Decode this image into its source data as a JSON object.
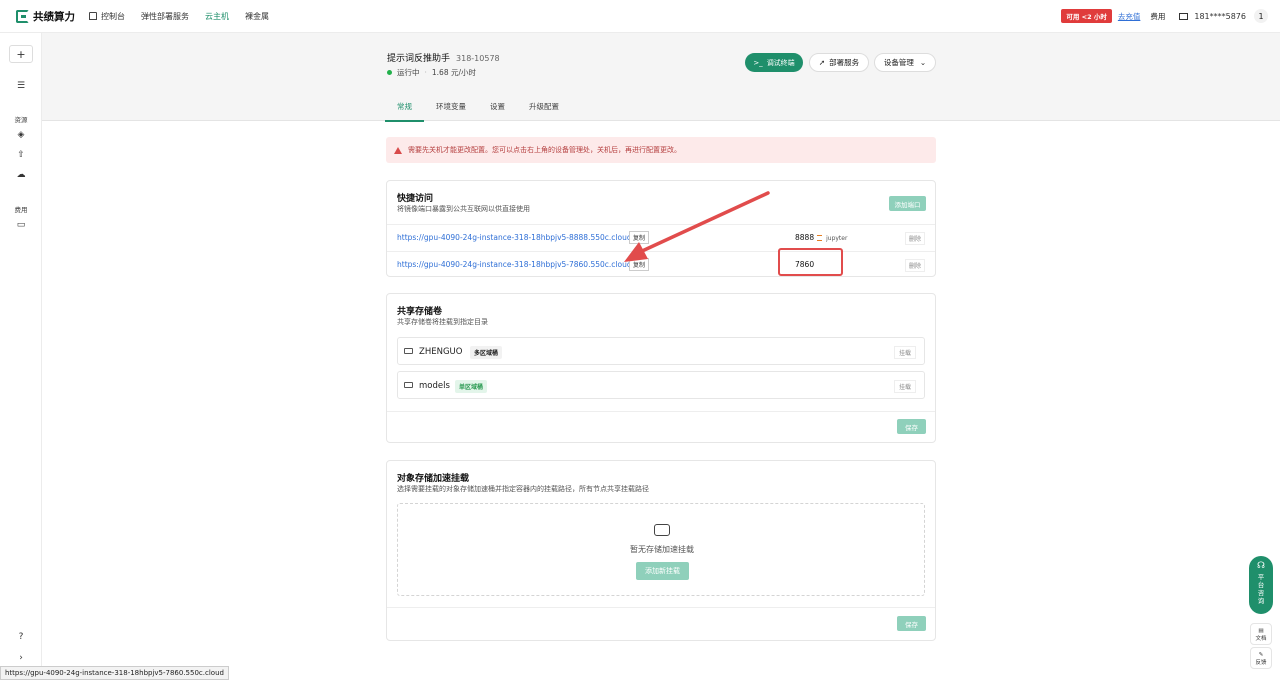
{
  "topbar": {
    "brand": "共绩算力",
    "nav": [
      {
        "label": "控制台",
        "icon": "home-icon"
      },
      {
        "label": "弹性部署服务"
      },
      {
        "label": "云主机",
        "active": true
      },
      {
        "label": "裸金属"
      }
    ],
    "badge": "可用 <2 小时",
    "recharge": "去充值",
    "fee": "费用",
    "phone": "181****5876",
    "notif_count": "1"
  },
  "sidebar": {
    "plus": "+",
    "group_resources": "资源",
    "group_fees": "费用"
  },
  "instance": {
    "title": "提示词反推助手",
    "id": "318-10578",
    "status": "运行中",
    "price": "1.68 元/小时",
    "btn_terminal": "调试终端",
    "btn_deploy": "部署服务",
    "btn_manage": "设备管理"
  },
  "tabs": [
    "常规",
    "环境变量",
    "设置",
    "升级配置"
  ],
  "warning": "需要先关机才能更改配置。您可以点击右上角的设备管理处，关机后，再进行配置更改。",
  "quick_access": {
    "title": "快捷访问",
    "subtitle": "将镜像端口暴露到公共互联网以供直接使用",
    "add_port": "添加端口",
    "copy": "复制",
    "delete": "删除",
    "rows": [
      {
        "url": "https://gpu-4090-24g-instance-318-18hbpjv5-8888.550c.cloud",
        "port": "8888",
        "app": "jupyter"
      },
      {
        "url": "https://gpu-4090-24g-instance-318-18hbpjv5-7860.550c.cloud",
        "port": "7860",
        "app": ""
      }
    ]
  },
  "shared_storage": {
    "title": "共享存储卷",
    "subtitle": "共享存储卷将挂载到指定目录",
    "mount": "挂载",
    "save": "保存",
    "volumes": [
      {
        "name": "ZHENGUO",
        "tag": "多区域桶"
      },
      {
        "name": "models",
        "tag": "单区域桶"
      }
    ]
  },
  "object_storage": {
    "title": "对象存储加速挂载",
    "subtitle": "选择需要挂载的对象存储加速桶并指定容器内的挂载路径，所有节点共享挂载路径",
    "empty": "暂无存储加速挂载",
    "add": "添加新挂载",
    "save": "保存"
  },
  "float": {
    "help": [
      "平",
      "台",
      "咨",
      "询"
    ],
    "docs": "文档",
    "feedback": "反馈"
  },
  "status_bar_url": "https://gpu-4090-24g-instance-318-18hbpjv5-7860.550c.cloud",
  "colors": {
    "brand": "#1f8f6b",
    "warning_bg": "#fdeaea",
    "link": "#2f6fd6",
    "annotation": "#e14c4c"
  }
}
